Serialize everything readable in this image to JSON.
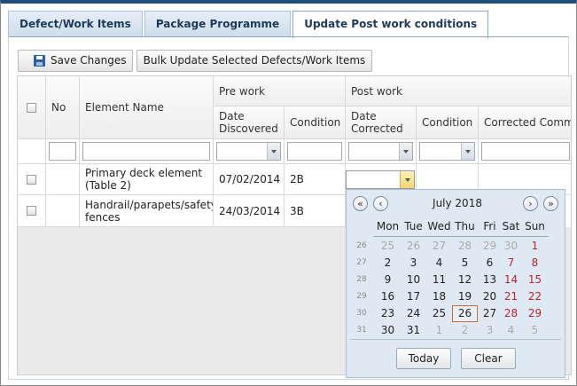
{
  "tabs": [
    {
      "label": "Defect/Work Items"
    },
    {
      "label": "Package Programme"
    },
    {
      "label": "Update Post work conditions"
    }
  ],
  "toolbar": {
    "save_label": "Save Changes",
    "bulk_label": "Bulk Update Selected Defects/Work Items"
  },
  "grid": {
    "headers": {
      "no": "No",
      "element_name": "Element Name",
      "pre_work": "Pre work",
      "post_work": "Post work",
      "date_discovered": "Date Discovered",
      "condition": "Condition",
      "date_corrected": "Date Corrected",
      "post_condition": "Condition",
      "corrected_comments": "Corrected Comme"
    },
    "rows": [
      {
        "element": "Primary deck element (Table 2)",
        "date_discovered": "07/02/2014",
        "condition": "2B"
      },
      {
        "element": "Handrail/parapets/safety fences",
        "date_discovered": "24/03/2014",
        "condition": "3B"
      }
    ]
  },
  "calendar": {
    "title": "July 2018",
    "prev_year": "«",
    "prev_month": "‹",
    "next_month": "›",
    "next_year": "»",
    "days_of_week": [
      "Mon",
      "Tue",
      "Wed",
      "Thu",
      "Fri",
      "Sat",
      "Sun"
    ],
    "week_numbers": [
      "26",
      "27",
      "28",
      "29",
      "30",
      "31"
    ],
    "weeks": [
      [
        "25",
        "26",
        "27",
        "28",
        "29",
        "30",
        "1"
      ],
      [
        "2",
        "3",
        "4",
        "5",
        "6",
        "7",
        "8"
      ],
      [
        "9",
        "10",
        "11",
        "12",
        "13",
        "14",
        "15"
      ],
      [
        "16",
        "17",
        "18",
        "19",
        "20",
        "21",
        "22"
      ],
      [
        "23",
        "24",
        "25",
        "26",
        "27",
        "28",
        "29"
      ],
      [
        "30",
        "31",
        "1",
        "2",
        "3",
        "4",
        "5"
      ]
    ],
    "selected_day": "26",
    "today_label": "Today",
    "clear_label": "Clear"
  }
}
